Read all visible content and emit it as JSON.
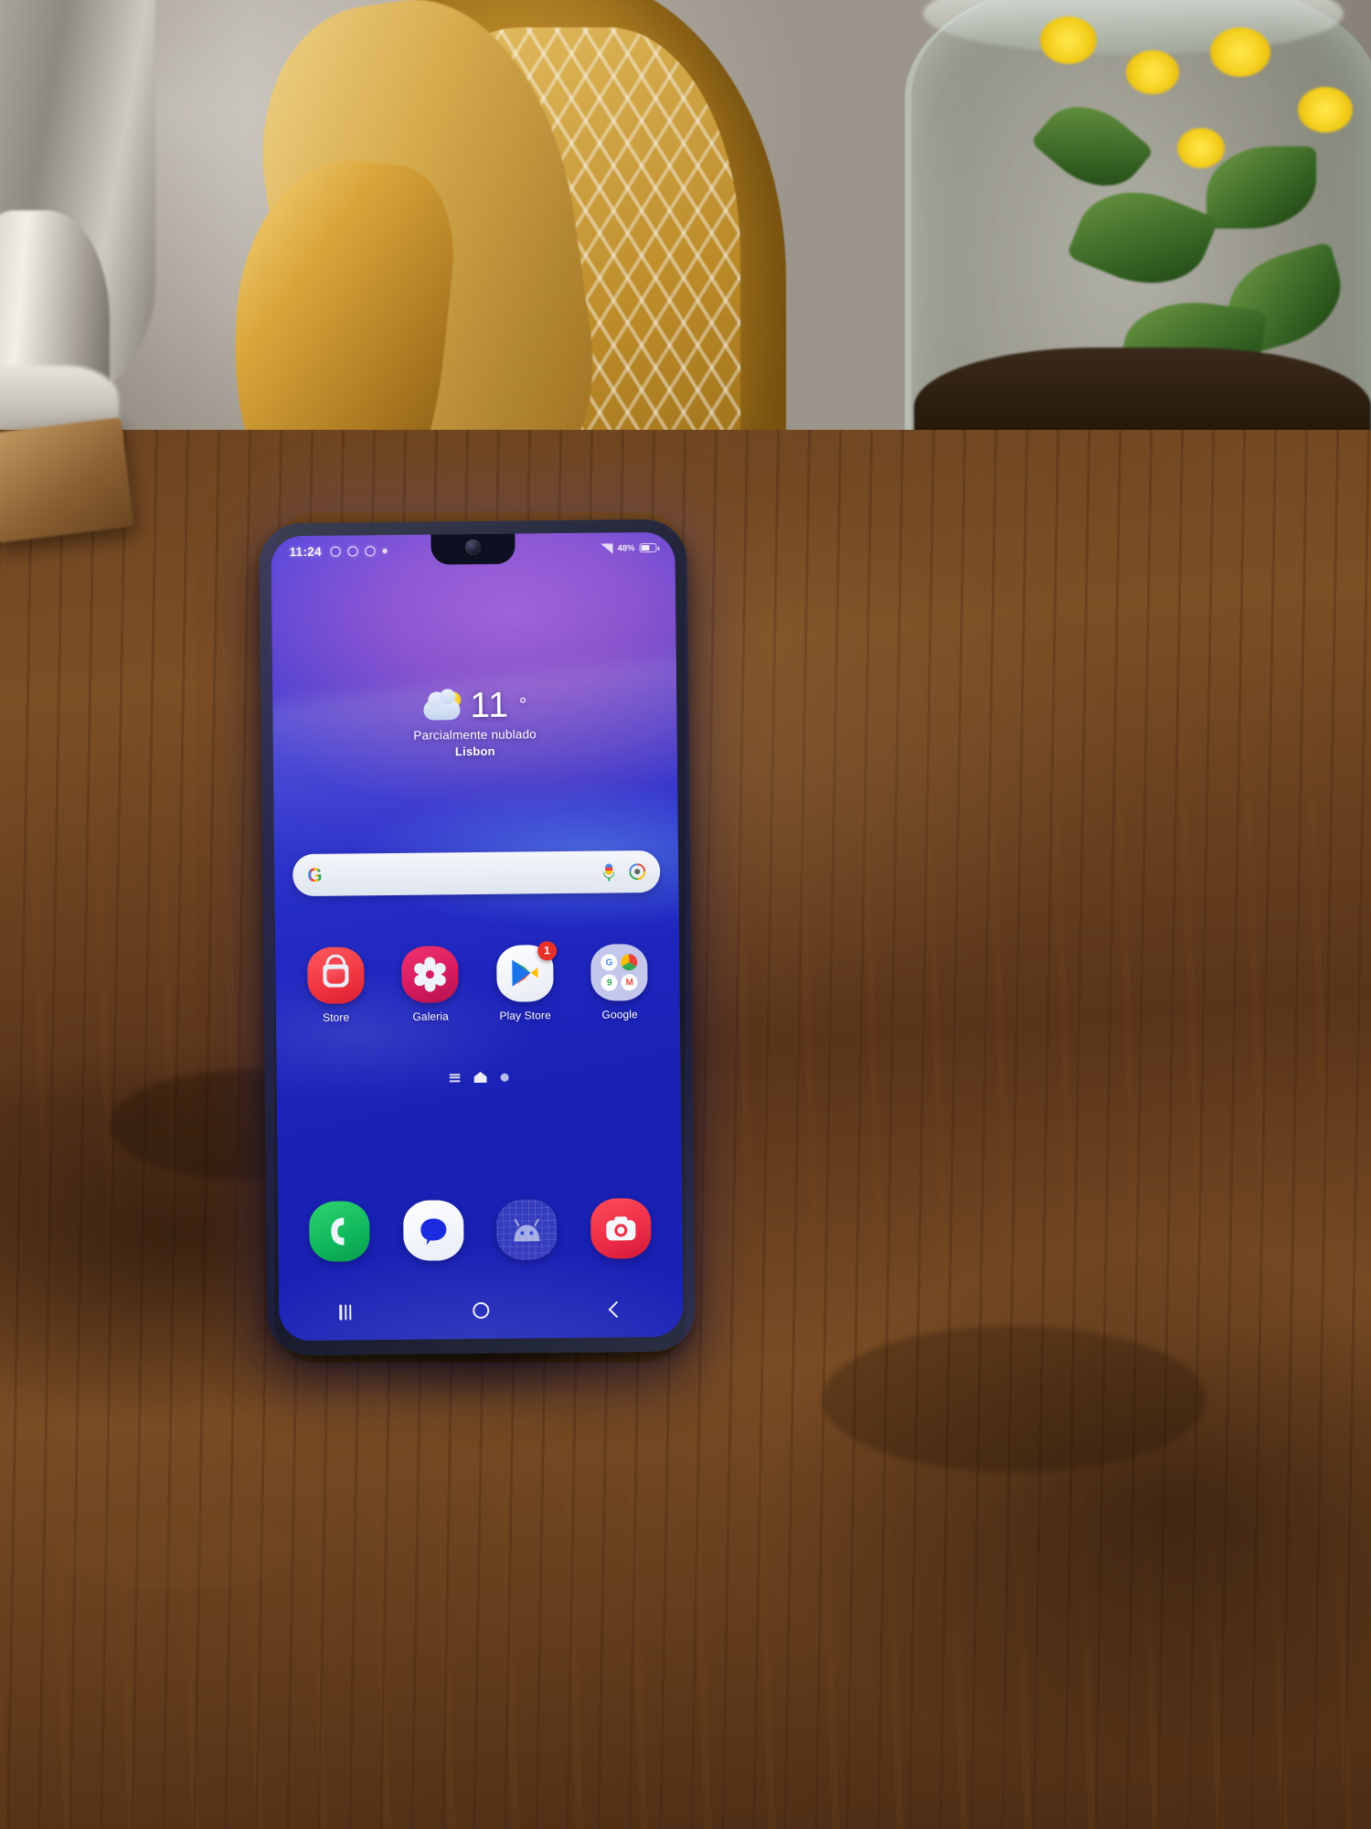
{
  "scene": {
    "description": "Samsung Galaxy phone home screen on a wooden table",
    "background_objects": [
      "golden-buddha-statue",
      "glass-terrarium-jar",
      "table-lamp-base",
      "wooden-table"
    ]
  },
  "phone": {
    "status_bar": {
      "time": "11:24",
      "left_icons": [
        "notification-dot-icon",
        "notification-dot-icon",
        "notification-dot-icon",
        "notification-small-dot-icon"
      ],
      "right_icons": [
        "signal-icon",
        "battery-icon"
      ],
      "battery_text": "48%"
    },
    "weather_widget": {
      "icon": "partly-cloudy-icon",
      "temperature": "11",
      "degree": "°",
      "description": "Parcialmente nublado",
      "city": "Lisbon"
    },
    "search_bar": {
      "logo": "google-g-icon",
      "placeholder": "",
      "value": "",
      "mic_icon": "microphone-icon",
      "lens_icon": "google-lens-icon"
    },
    "app_grid": [
      {
        "label": "Store",
        "icon": "galaxy-store-icon",
        "badge": ""
      },
      {
        "label": "Galeria",
        "icon": "gallery-icon",
        "badge": ""
      },
      {
        "label": "Play Store",
        "icon": "play-store-icon",
        "badge": "1"
      },
      {
        "label": "Google",
        "icon": "google-folder-icon",
        "badge": "",
        "folder_items": [
          "G",
          "C",
          "M",
          "M"
        ]
      }
    ],
    "page_indicator": {
      "items": [
        "apps-list-icon",
        "home-page-icon",
        "page-dot-icon"
      ],
      "active_index": 1
    },
    "dock": [
      {
        "label": "",
        "icon": "phone-icon"
      },
      {
        "label": "",
        "icon": "messages-icon"
      },
      {
        "label": "",
        "icon": "apps-drawer-icon"
      },
      {
        "label": "",
        "icon": "camera-icon"
      }
    ],
    "nav_bar": [
      {
        "icon": "recents-icon"
      },
      {
        "icon": "home-icon"
      },
      {
        "icon": "back-icon"
      }
    ],
    "colors": {
      "wallpaper_top": "#9b59d9",
      "wallpaper_bottom": "#2f2ee6",
      "badge": "#e8302a",
      "store": "#ea2e3c",
      "gallery": "#d81b60",
      "phone_green": "#0fb85c",
      "camera_red": "#ec2c45"
    }
  }
}
